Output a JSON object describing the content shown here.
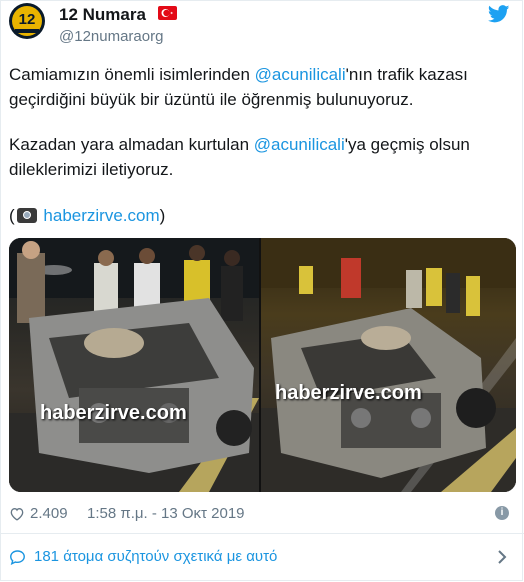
{
  "account": {
    "name": "12 Numara",
    "handle": "@12numaraorg",
    "avatar_text": "12"
  },
  "tweet": {
    "p1_pre": "Camiamızın önemli isimlerinden ",
    "p1_mention": "@acunilicali",
    "p1_post": "'nın trafik kazası",
    "p1_line2": "geçirdiğini büyük bir üzüntü ile öğrenmiş bulunuyoruz.",
    "p2_pre": "Kazadan yara almadan kurtulan ",
    "p2_mention": "@acunilicali",
    "p2_post": "'ya geçmiş olsun",
    "p2_line2": "dileklerimizi iletiyoruz.",
    "source_open": "(",
    "source_link": "haberzirve.com",
    "source_close": ")"
  },
  "media": {
    "watermark_left": "haberzirve.com",
    "watermark_right": "haberzirve.com"
  },
  "footer": {
    "likes": "2.409",
    "timestamp": "1:58 π.μ. - 13 Οκτ 2019",
    "conversation": "181 άτομα συζητούν σχετικά με αυτό"
  },
  "colors": {
    "link": "#1b95e0",
    "muted": "#657786",
    "flag": "#e30a17"
  },
  "icons": [
    "twitter-bird-icon",
    "turkish-flag-icon",
    "camera-icon",
    "heart-icon",
    "info-icon",
    "speech-bubble-icon",
    "chevron-right-icon"
  ]
}
